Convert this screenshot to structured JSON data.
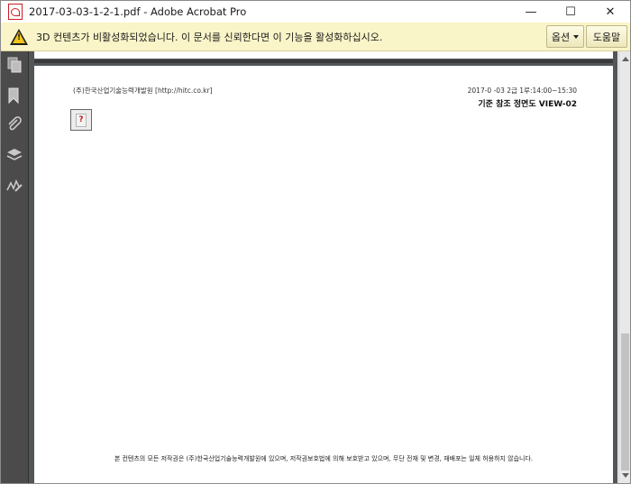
{
  "window": {
    "title": "2017-03-03-1-2-1.pdf - Adobe Acrobat Pro",
    "minimize_glyph": "—",
    "maximize_glyph": "☐",
    "close_glyph": "✕"
  },
  "warning_bar": {
    "message": "3D 컨텐츠가 비활성화되었습니다. 이 문서를 신뢰한다면 이 기능을 활성화하십시오.",
    "options_label": "옵션",
    "help_label": "도움말",
    "icon": "warning-icon"
  },
  "nav_pane": {
    "icons": [
      "pages-icon",
      "bookmark-icon",
      "attachment-icon",
      "layers-icon",
      "signature-icon"
    ]
  },
  "document": {
    "header_left": "(주)한국산업기술능력개발원 [http://hitc.co.kr]",
    "header_right": "2017-0  -03 2급 1루:14:00~15:30",
    "view_title": "기준 참조 정면도 VIEW-02",
    "missing_image_glyph": "?",
    "footer_notice": "본 컨텐츠의 모든 저작권은 (주)한국산업기술능력개발원에 있으며, 저작권보호법에 의해 보호받고 있으며, 무단 전재 및 변경, 재배포는 일체 허용하지 않습니다."
  },
  "colors": {
    "warning_bar": "#faf5c8",
    "nav_pane": "#4b4b4b",
    "doc_background": "#525659",
    "acrobat_red": "#c81e1e"
  }
}
